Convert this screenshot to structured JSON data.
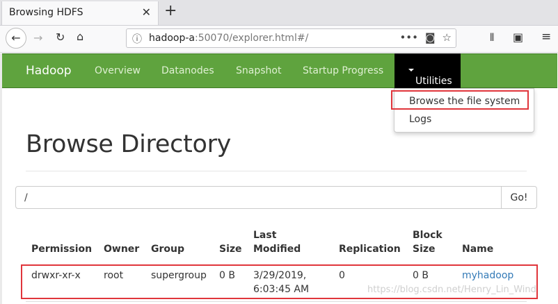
{
  "browser": {
    "tab_title": "Browsing HDFS",
    "url_host": "hadoop-a",
    "url_rest": ":50070/explorer.html#/"
  },
  "nav": {
    "brand": "Hadoop",
    "links": [
      "Overview",
      "Datanodes",
      "Snapshot",
      "Startup Progress"
    ],
    "utilities": "Utilities"
  },
  "dropdown": {
    "items": [
      "Browse the file system",
      "Logs"
    ]
  },
  "page": {
    "title": "Browse Directory",
    "path_value": "/",
    "go_label": "Go!"
  },
  "table": {
    "headers": {
      "permission": "Permission",
      "owner": "Owner",
      "group": "Group",
      "size": "Size",
      "last_modified_1": "Last",
      "last_modified_2": "Modified",
      "replication": "Replication",
      "block_size_1": "Block",
      "block_size_2": "Size",
      "name": "Name"
    },
    "rows": [
      {
        "permission": "drwxr-xr-x",
        "owner": "root",
        "group": "supergroup",
        "size": "0 B",
        "modified_date": "3/29/2019,",
        "modified_time": "6:03:45 AM",
        "replication": "0",
        "block_size": "0 B",
        "name": "myhadoop"
      }
    ]
  },
  "watermark": "https://blog.csdn.net/Henry_Lin_Wind",
  "colors": {
    "nav_green": "#5fa33e",
    "utilities_bg": "#000000",
    "highlight_red": "#e0353b",
    "link_blue": "#337ab7"
  }
}
